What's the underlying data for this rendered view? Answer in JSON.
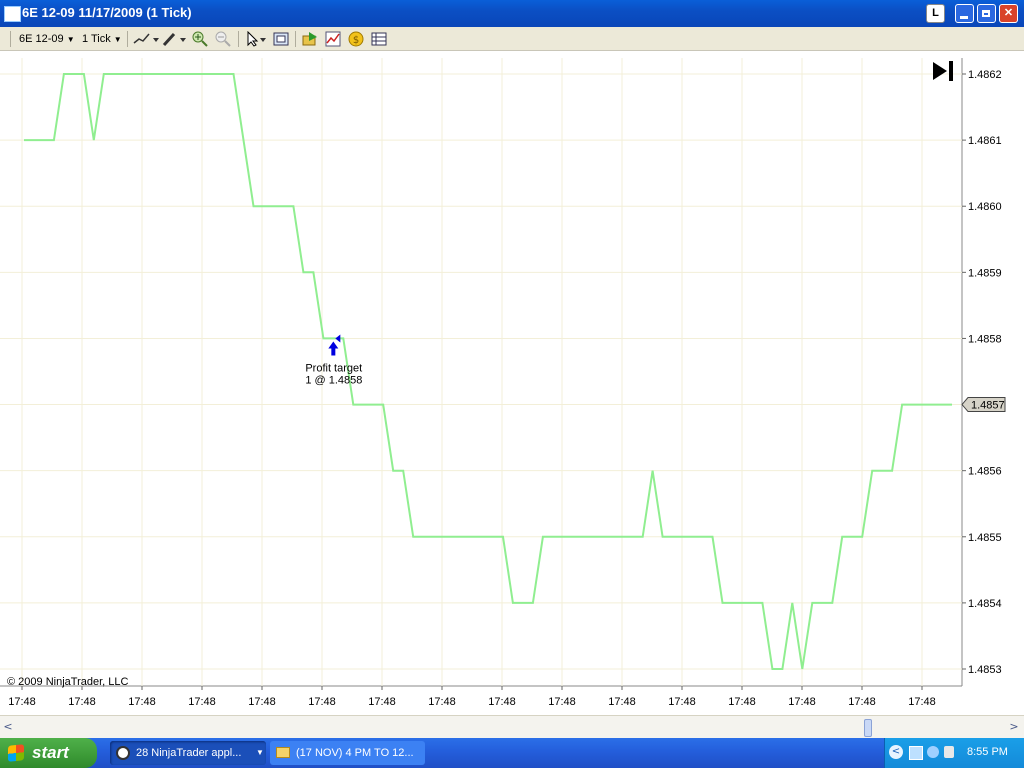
{
  "window": {
    "title": "6E 12-09  11/17/2009 (1 Tick)",
    "title_buttons": [
      "L"
    ]
  },
  "toolbar": {
    "instrument": "6E 12-09",
    "interval": "1 Tick"
  },
  "chart_data": {
    "type": "line",
    "series": [
      {
        "values": [
          [
            0,
            1.4861
          ],
          [
            3,
            1.4861
          ],
          [
            4,
            1.4862
          ],
          [
            6,
            1.4862
          ],
          [
            7,
            1.4861
          ],
          [
            8,
            1.4862
          ],
          [
            21,
            1.4862
          ],
          [
            23,
            1.486
          ],
          [
            27,
            1.486
          ],
          [
            28,
            1.4859
          ],
          [
            29,
            1.4859
          ],
          [
            30,
            1.4858
          ],
          [
            32,
            1.4858
          ],
          [
            33,
            1.4857
          ],
          [
            36,
            1.4857
          ],
          [
            37,
            1.4856
          ],
          [
            38,
            1.4856
          ],
          [
            39,
            1.4855
          ],
          [
            48,
            1.4855
          ],
          [
            49,
            1.4854
          ],
          [
            51,
            1.4854
          ],
          [
            52,
            1.4855
          ],
          [
            62,
            1.4855
          ],
          [
            63,
            1.4856
          ],
          [
            64,
            1.4855
          ],
          [
            69,
            1.4855
          ],
          [
            70,
            1.4854
          ],
          [
            74,
            1.4854
          ],
          [
            75,
            1.4853
          ],
          [
            76,
            1.4853
          ],
          [
            77,
            1.4854
          ],
          [
            78,
            1.4853
          ],
          [
            79,
            1.4854
          ],
          [
            81,
            1.4854
          ],
          [
            82,
            1.4855
          ],
          [
            84,
            1.4855
          ],
          [
            85,
            1.4856
          ],
          [
            87,
            1.4856
          ],
          [
            88,
            1.4857
          ],
          [
            93,
            1.4857
          ]
        ]
      }
    ],
    "ylim": [
      1.4853,
      1.4862
    ],
    "yticks": [
      "1.4862",
      "1.4861",
      "1.4860",
      "1.4859",
      "1.4858",
      "1.4857",
      "1.4856",
      "1.4855",
      "1.4854",
      "1.4853"
    ],
    "xticks": [
      "17:48",
      "17:48",
      "17:48",
      "17:48",
      "17:48",
      "17:48",
      "17:48",
      "17:48",
      "17:48",
      "17:48",
      "17:48",
      "17:48",
      "17:48",
      "17:48",
      "17:48",
      "17:48"
    ],
    "last_price": "1.4857",
    "line_color": "#90ee90",
    "grid": true,
    "annotation": {
      "line1": "Profit target",
      "line2": "1 @ 1.4858",
      "x": 31,
      "y": 1.4858
    },
    "copyright": "© 2009 NinjaTrader, LLC"
  },
  "taskbar": {
    "start_label": "start",
    "tasks": [
      {
        "label": "28 NinjaTrader appl..."
      },
      {
        "label": "(17 NOV) 4 PM TO 12..."
      }
    ],
    "clock": "8:55 PM"
  }
}
